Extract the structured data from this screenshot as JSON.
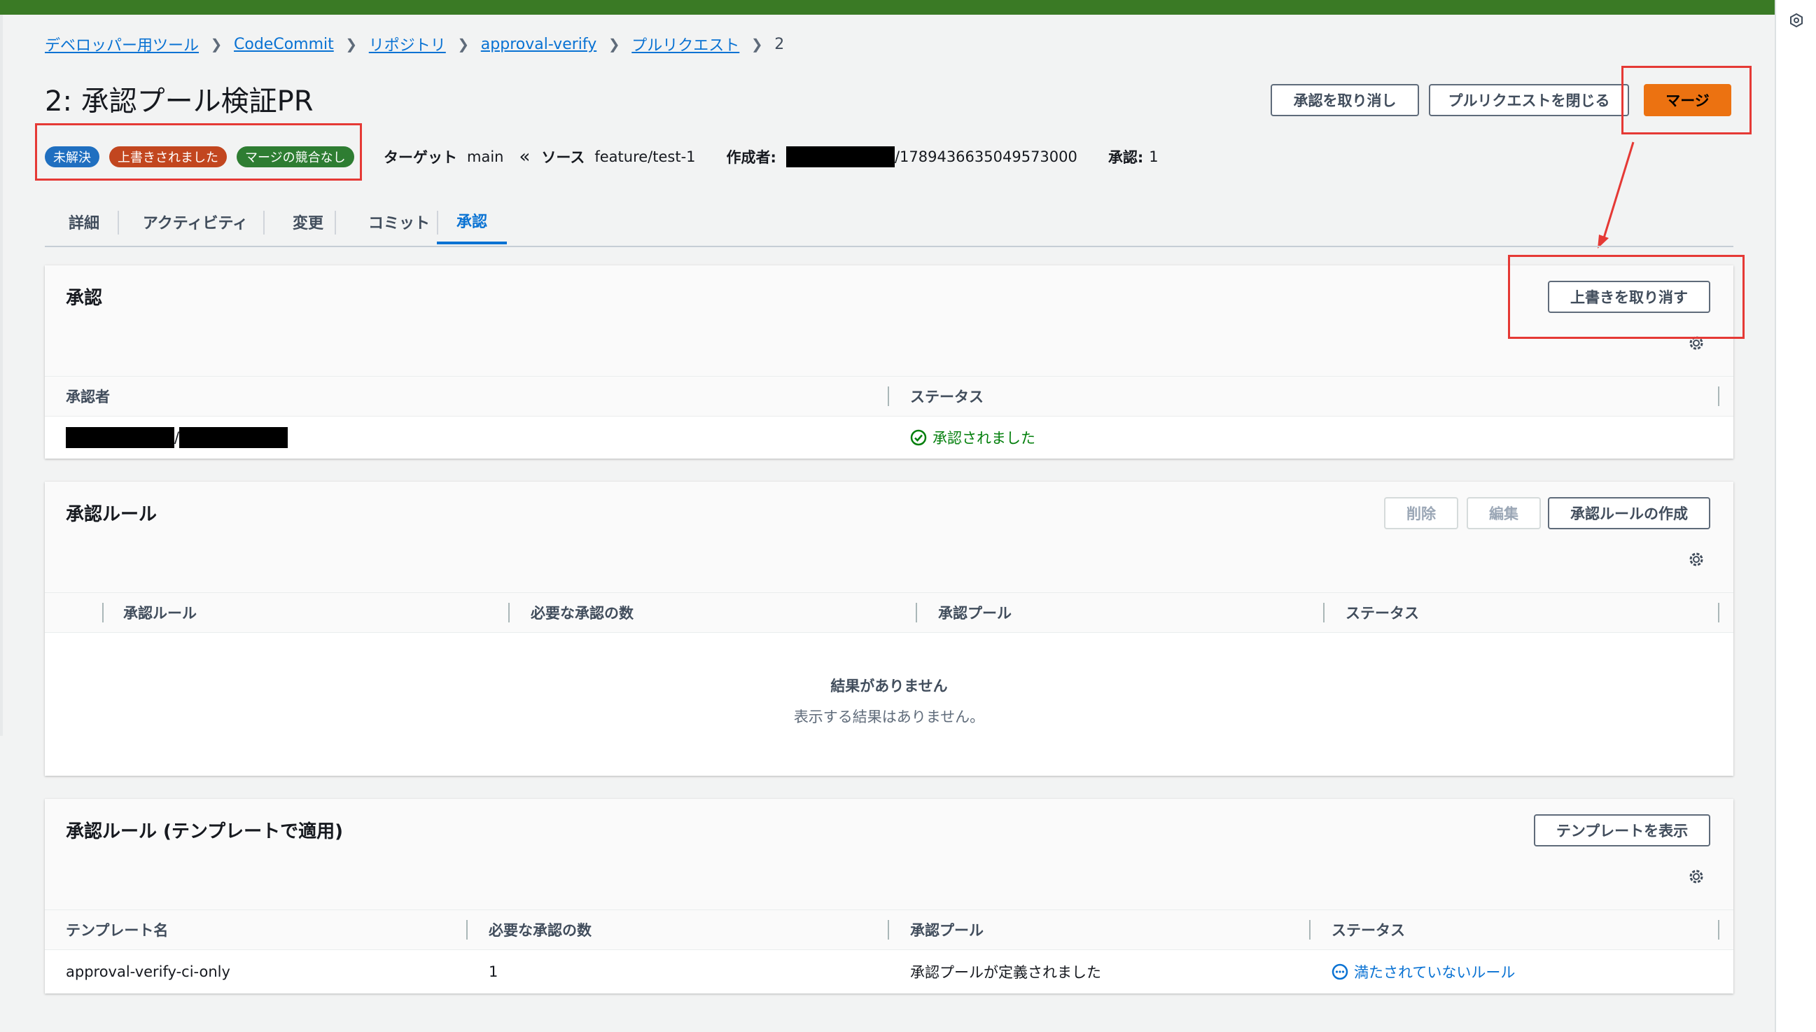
{
  "breadcrumb": {
    "items": [
      "デベロッパー用ツール",
      "CodeCommit",
      "リポジトリ",
      "approval-verify",
      "プルリクエスト"
    ],
    "current": "2"
  },
  "page": {
    "title": "2: 承認プール検証PR"
  },
  "header_buttons": {
    "revoke_approval": "承認を取り消し",
    "close_pr": "プルリクエストを閉じる",
    "merge": "マージ"
  },
  "badges": [
    {
      "label": "未解決",
      "color": "#1f6fc0"
    },
    {
      "label": "上書きされました",
      "color": "#c2461f"
    },
    {
      "label": "マージの競合なし",
      "color": "#2e7d32"
    }
  ],
  "meta": {
    "target_label": "ターゲット",
    "target_value": "main",
    "source_label": "ソース",
    "source_value": "feature/test-1",
    "author_label": "作成者:",
    "author_suffix": "/1789436635049573000",
    "approvals_label": "承認:",
    "approvals_value": "1"
  },
  "tabs": [
    "詳細",
    "アクティビティ",
    "変更",
    "コミット",
    "承認"
  ],
  "active_tab": "承認",
  "approvals_panel": {
    "title": "承認",
    "override_button": "上書きを取り消す",
    "columns": [
      "承認者",
      "ステータス"
    ],
    "rows": [
      {
        "approver_sep": "/",
        "status": "承認されました"
      }
    ]
  },
  "rules_panel": {
    "title": "承認ルール",
    "delete_button": "削除",
    "edit_button": "編集",
    "create_button": "承認ルールの作成",
    "columns": [
      "承認ルール",
      "必要な承認の数",
      "承認プール",
      "ステータス"
    ],
    "empty_title": "結果がありません",
    "empty_desc": "表示する結果はありません。"
  },
  "template_panel": {
    "title": "承認ルール (テンプレートで適用)",
    "show_template_button": "テンプレートを表示",
    "columns": [
      "テンプレート名",
      "必要な承認の数",
      "承認プール",
      "ステータス"
    ],
    "rows": [
      {
        "name": "approval-verify-ci-only",
        "required": "1",
        "pool": "承認プールが定義されました",
        "status": "満たされていないルール"
      }
    ]
  },
  "colors": {
    "accent": "#0972d3",
    "merge": "#ec7211",
    "success": "#037f0c",
    "highlight": "#e53935",
    "topbar": "#3a7a25"
  }
}
